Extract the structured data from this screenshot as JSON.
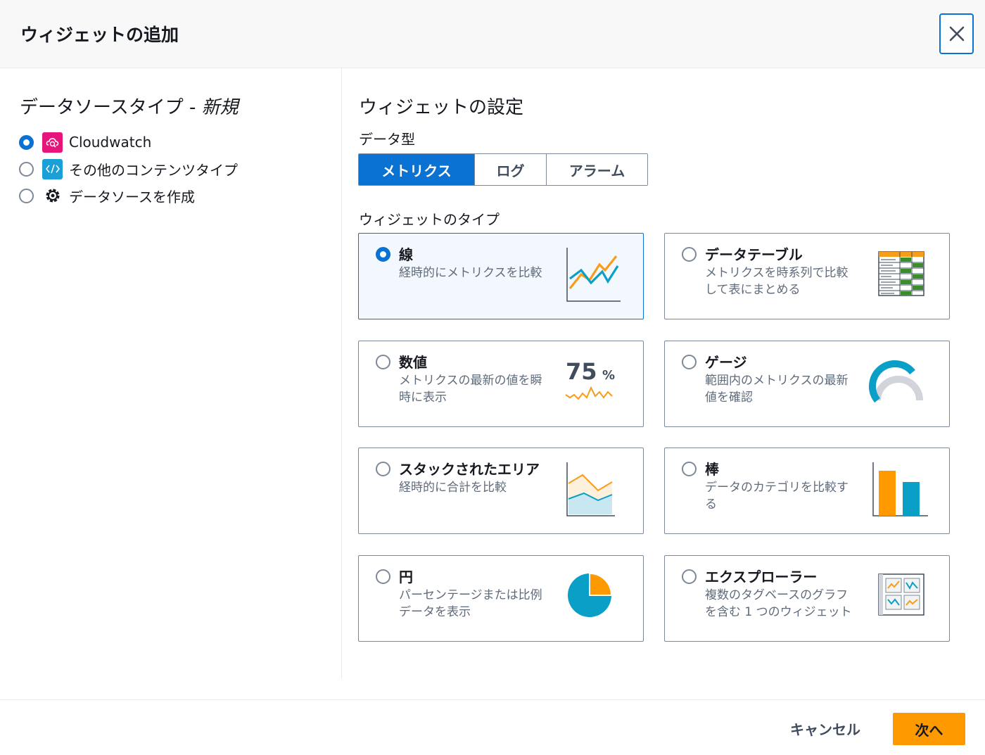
{
  "header": {
    "title": "ウィジェットの追加"
  },
  "left": {
    "title": "データソースタイプ -",
    "title_tag": "新規",
    "options": [
      {
        "label": "Cloudwatch",
        "selected": true,
        "icon": "cloudwatch-icon"
      },
      {
        "label": "その他のコンテンツタイプ",
        "selected": false,
        "icon": "code-icon"
      },
      {
        "label": "データソースを作成",
        "selected": false,
        "icon": "gear-icon"
      }
    ]
  },
  "right": {
    "title": "ウィジェットの設定",
    "data_type_label": "データ型",
    "data_types": [
      {
        "label": "メトリクス",
        "active": true
      },
      {
        "label": "ログ",
        "active": false
      },
      {
        "label": "アラーム",
        "active": false
      }
    ],
    "widget_type_label": "ウィジェットのタイプ",
    "cards": [
      {
        "title": "線",
        "desc": "経時的にメトリクスを比較",
        "selected": true,
        "icon": "line-chart-icon"
      },
      {
        "title": "データテーブル",
        "desc": "メトリクスを時系列で比較して表にまとめる",
        "selected": false,
        "icon": "data-table-icon"
      },
      {
        "title": "数値",
        "desc": "メトリクスの最新の値を瞬時に表示",
        "selected": false,
        "icon": "number-icon",
        "icon_value": "75",
        "icon_unit": "%"
      },
      {
        "title": "ゲージ",
        "desc": "範囲内のメトリクスの最新値を確認",
        "selected": false,
        "icon": "gauge-icon"
      },
      {
        "title": "スタックされたエリア",
        "desc": "経時的に合計を比較",
        "selected": false,
        "icon": "stacked-area-icon"
      },
      {
        "title": "棒",
        "desc": "データのカテゴリを比較する",
        "selected": false,
        "icon": "bar-chart-icon"
      },
      {
        "title": "円",
        "desc": "パーセンテージまたは比例データを表示",
        "selected": false,
        "icon": "pie-chart-icon"
      },
      {
        "title": "エクスプローラー",
        "desc": "複数のタグベースのグラフを含む 1 つのウィジェット",
        "selected": false,
        "icon": "explorer-icon"
      }
    ]
  },
  "footer": {
    "cancel_label": "キャンセル",
    "next_label": "次へ"
  },
  "colors": {
    "accent": "#0972d3",
    "primary_button": "#ff9900",
    "orange": "#f89c1c",
    "teal": "#0a9fc7"
  }
}
